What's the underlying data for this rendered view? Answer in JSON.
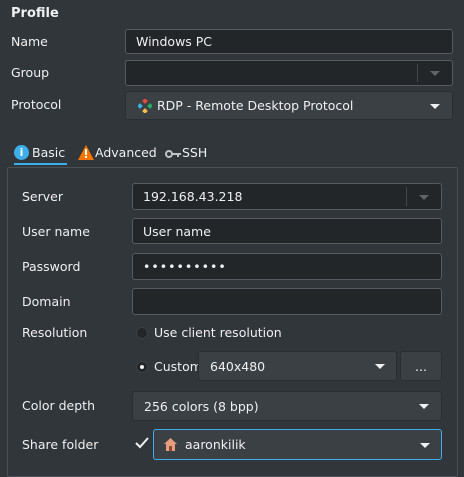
{
  "profile": {
    "title": "Profile",
    "name_label": "Name",
    "name_value": "Windows PC",
    "group_label": "Group",
    "group_value": "",
    "protocol_label": "Protocol",
    "protocol_value": "RDP - Remote Desktop Protocol",
    "protocol_icon": "rdp-diamond-icon"
  },
  "tabs": [
    {
      "label": "Basic",
      "icon": "info-icon",
      "selected": true
    },
    {
      "label": "Advanced",
      "icon": "warning-icon",
      "selected": false
    },
    {
      "label": "SSH",
      "icon": "key-icon",
      "selected": false
    }
  ],
  "basic": {
    "server_label": "Server",
    "server_value": "192.168.43.218",
    "username_label": "User name",
    "username_value": "User name",
    "password_label": "Password",
    "password_value": "••••••••••",
    "domain_label": "Domain",
    "domain_value": "",
    "resolution_label": "Resolution",
    "use_client_resolution_label": "Use client resolution",
    "custom_label": "Custom",
    "custom_resolution_value": "640x480",
    "more_button_label": "...",
    "color_depth_label": "Color depth",
    "color_depth_value": "256 colors (8 bpp)",
    "share_folder_label": "Share folder",
    "share_folder_checked": true,
    "share_folder_value": "aaronkilik",
    "share_folder_icon": "home-folder-icon"
  },
  "colors": {
    "background": "#31363b",
    "field": "#232629",
    "accent": "#3daee9",
    "text": "#eff0f1"
  }
}
